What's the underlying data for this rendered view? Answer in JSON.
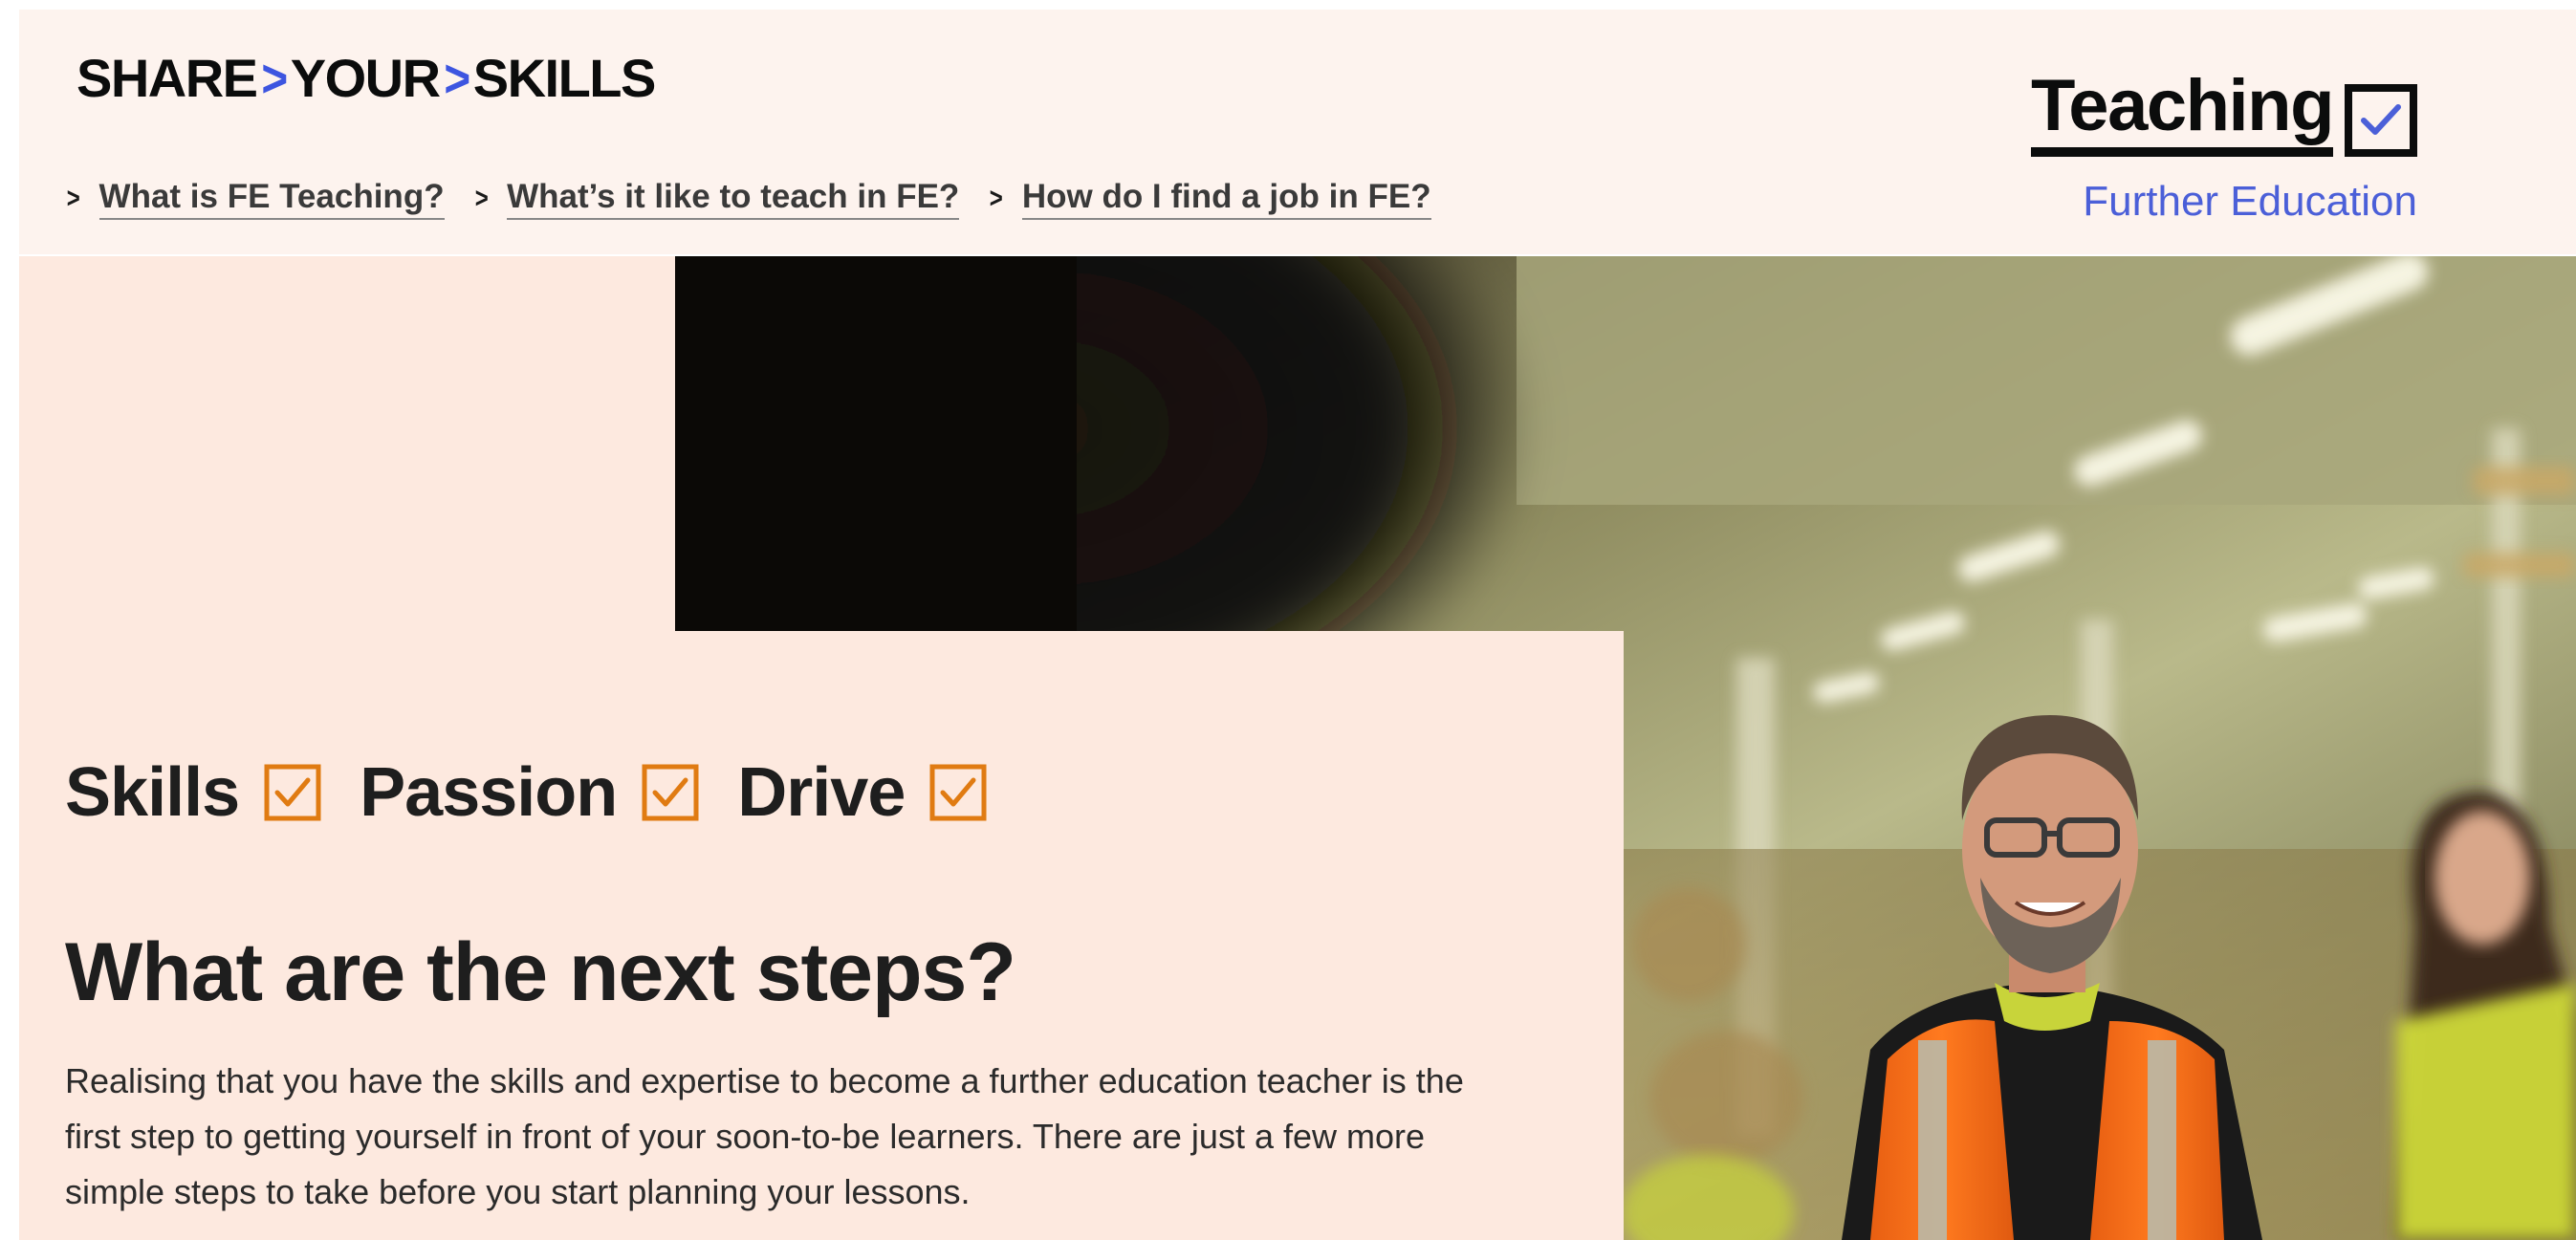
{
  "header": {
    "logo": {
      "part1": "SHARE",
      "part2": "YOUR",
      "part3": "SKILLS",
      "separator": ">"
    },
    "nav": [
      {
        "label": "What is FE Teaching?"
      },
      {
        "label": "What’s it like to teach in FE?"
      },
      {
        "label": "How do I find a job in FE?"
      }
    ],
    "brand": {
      "word": "Teaching",
      "subtitle": "Further Education",
      "icon": "checkbox-ticked-icon",
      "accent_color": "#4b5fd8"
    }
  },
  "hero": {
    "taglines": [
      {
        "label": "Skills",
        "icon": "orange-checkbox-icon"
      },
      {
        "label": "Passion",
        "icon": "orange-checkbox-icon"
      },
      {
        "label": "Drive",
        "icon": "orange-checkbox-icon"
      }
    ],
    "heading": "What are the next steps?",
    "body": "Realising that you have the skills and expertise to become a further education teacher is the first step to getting yourself in front of your soon-to-be learners. There are just a few more simple steps to take before you start planning your lessons.",
    "background_color": "#fde9df",
    "check_color": "#e07b12"
  }
}
